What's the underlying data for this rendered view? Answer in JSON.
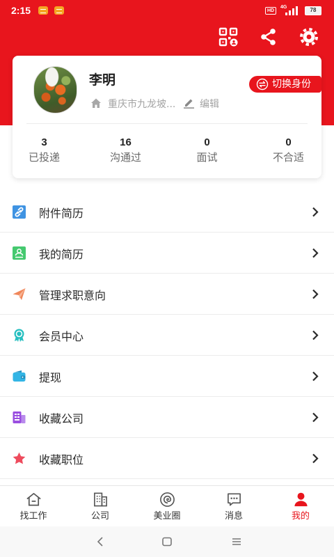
{
  "status_bar": {
    "time": "2:15",
    "hd": "HD",
    "network": "4G",
    "battery": "78"
  },
  "header": {
    "actions": [
      {
        "icon": "qr-code-icon"
      },
      {
        "icon": "share-icon"
      },
      {
        "icon": "settings-icon"
      }
    ]
  },
  "profile": {
    "name": "李明",
    "location": "重庆市九龙坡...",
    "edit_label": "编辑",
    "switch_identity_label": "切换身份"
  },
  "stats": [
    {
      "value": "3",
      "label": "已投递"
    },
    {
      "value": "16",
      "label": "沟通过"
    },
    {
      "value": "0",
      "label": "面试"
    },
    {
      "value": "0",
      "label": "不合适"
    }
  ],
  "menu": [
    {
      "label": "附件简历",
      "icon": "link-icon",
      "color": "#3f93e2"
    },
    {
      "label": "我的简历",
      "icon": "resume-icon",
      "color": "#45c96f"
    },
    {
      "label": "管理求职意向",
      "icon": "paper-plane-icon",
      "color": "#f0875a"
    },
    {
      "label": "会员中心",
      "icon": "award-icon",
      "color": "#27bfc0"
    },
    {
      "label": "提现",
      "icon": "wallet-icon",
      "color": "#33b5e5"
    },
    {
      "label": "收藏公司",
      "icon": "company-icon",
      "color": "#9a4ee0"
    },
    {
      "label": "收藏职位",
      "icon": "star-icon",
      "color": "#ee4b5d"
    }
  ],
  "tabs": [
    {
      "label": "找工作",
      "icon": "home-icon",
      "active": false
    },
    {
      "label": "公司",
      "icon": "building-icon",
      "active": false
    },
    {
      "label": "美业圈",
      "icon": "circle-icon",
      "active": false
    },
    {
      "label": "消息",
      "icon": "message-icon",
      "active": false
    },
    {
      "label": "我的",
      "icon": "person-icon",
      "active": true
    }
  ],
  "colors": {
    "brand": "#e8151d",
    "text": "#222222",
    "muted": "#a3a3a3",
    "divider": "#ececec"
  }
}
